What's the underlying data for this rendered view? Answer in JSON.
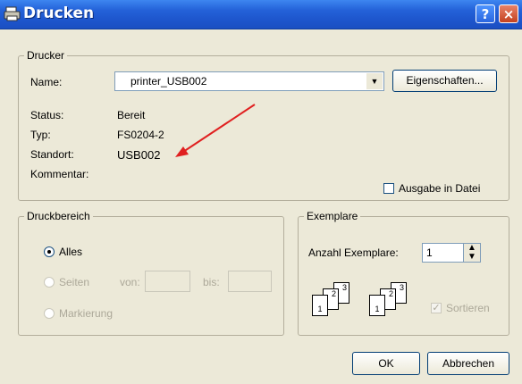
{
  "window": {
    "title": "Drucken",
    "help_symbol": "?",
    "close_symbol": "×"
  },
  "printer_group": {
    "legend": "Drucker",
    "name_label": "Name:",
    "name_value": "printer_USB002",
    "properties_button": "Eigenschaften...",
    "status_label": "Status:",
    "status_value": "Bereit",
    "type_label": "Typ:",
    "type_value": "FS0204-2",
    "location_label": "Standort:",
    "location_value": "USB002",
    "comment_label": "Kommentar:",
    "print_to_file_label": "Ausgabe in Datei",
    "print_to_file_checked": false
  },
  "range_group": {
    "legend": "Druckbereich",
    "all_label": "Alles",
    "all_selected": true,
    "pages_label": "Seiten",
    "from_label": "von:",
    "to_label": "bis:",
    "selection_label": "Markierung"
  },
  "copies_group": {
    "legend": "Exemplare",
    "count_label": "Anzahl Exemplare:",
    "count_value": "1",
    "collate_label": "Sortieren",
    "collate_checked": true,
    "page_numbers": [
      "1",
      "2",
      "3"
    ]
  },
  "buttons": {
    "ok": "OK",
    "cancel": "Abbrechen"
  },
  "colors": {
    "titlebar": "#2462d9",
    "face": "#ECE9D8",
    "annotation_arrow": "#e02020"
  }
}
